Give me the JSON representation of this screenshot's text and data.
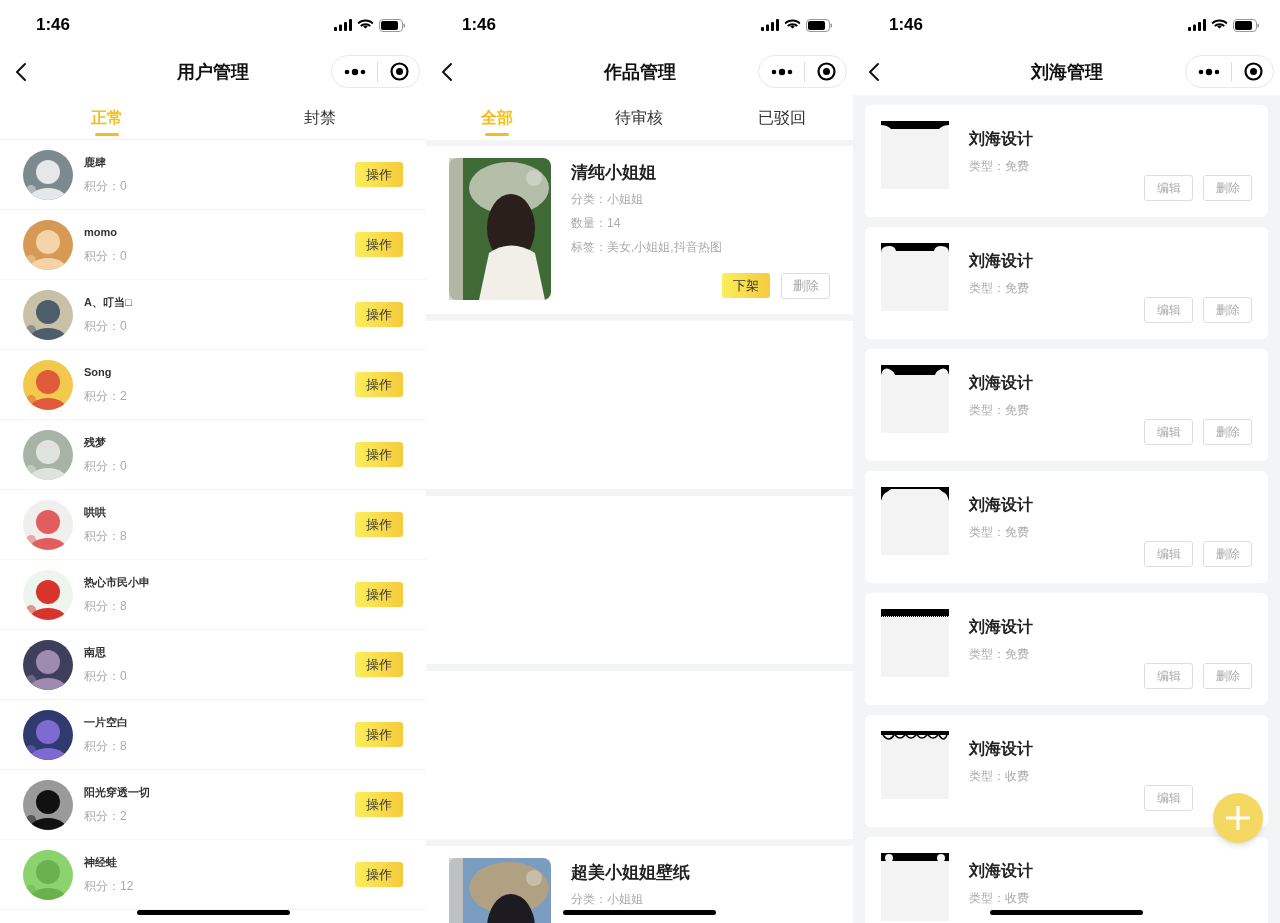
{
  "screens": [
    {
      "kind": "users",
      "time": "1:46",
      "title": "用户管理",
      "tabs": [
        {
          "label": "正常",
          "selected": true
        },
        {
          "label": "封禁",
          "selected": false
        }
      ],
      "users": [
        {
          "name": "鹿肆",
          "score": "积分：0",
          "action": "操作"
        },
        {
          "name": "momo",
          "score": "积分：0",
          "action": "操作"
        },
        {
          "name": "A、叮当□",
          "score": "积分：0",
          "action": "操作"
        },
        {
          "name": "Song",
          "score": "积分：2",
          "action": "操作"
        },
        {
          "name": "残梦",
          "score": "积分：0",
          "action": "操作"
        },
        {
          "name": "哄哄",
          "score": "积分：8",
          "action": "操作"
        },
        {
          "name": "热心市民小申",
          "score": "积分：8",
          "action": "操作"
        },
        {
          "name": "南思",
          "score": "积分：0",
          "action": "操作"
        },
        {
          "name": "一片空白",
          "score": "积分：8",
          "action": "操作"
        },
        {
          "name": "阳光穿透一切",
          "score": "积分：2",
          "action": "操作"
        },
        {
          "name": "神经蛙",
          "score": "积分：12",
          "action": "操作"
        }
      ]
    },
    {
      "kind": "works",
      "time": "1:46",
      "title": "作品管理",
      "tabs": [
        {
          "label": "全部",
          "selected": true
        },
        {
          "label": "待审核",
          "selected": false
        },
        {
          "label": "已驳回",
          "selected": false
        }
      ],
      "works": [
        {
          "kind": "work",
          "title": "清纯小姐姐",
          "fields": [
            "分类：小姐姐",
            "数量：14",
            "标签：美女,小姐姐,抖音热图"
          ],
          "buttons": [
            "下架",
            "删除"
          ]
        },
        {
          "kind": "blank"
        },
        {
          "kind": "blank"
        },
        {
          "kind": "blank"
        },
        {
          "kind": "work",
          "title": "超美小姐姐壁纸",
          "fields": [
            "分类：小姐姐"
          ]
        }
      ]
    },
    {
      "kind": "notches",
      "time": "1:46",
      "title": "刘海管理",
      "items": [
        {
          "title": "刘海设计",
          "type": "类型：免费",
          "buttons": [
            "编辑",
            "删除"
          ]
        },
        {
          "title": "刘海设计",
          "type": "类型：免费",
          "buttons": [
            "编辑",
            "删除"
          ]
        },
        {
          "title": "刘海设计",
          "type": "类型：免费",
          "buttons": [
            "编辑",
            "删除"
          ]
        },
        {
          "title": "刘海设计",
          "type": "类型：免费",
          "buttons": [
            "编辑",
            "删除"
          ]
        },
        {
          "title": "刘海设计",
          "type": "类型：免费",
          "buttons": [
            "编辑",
            "删除"
          ]
        },
        {
          "title": "刘海设计",
          "type": "类型：收费",
          "buttons": [
            "编辑"
          ]
        },
        {
          "title": "刘海设计",
          "type": "类型：收费"
        }
      ]
    }
  ]
}
